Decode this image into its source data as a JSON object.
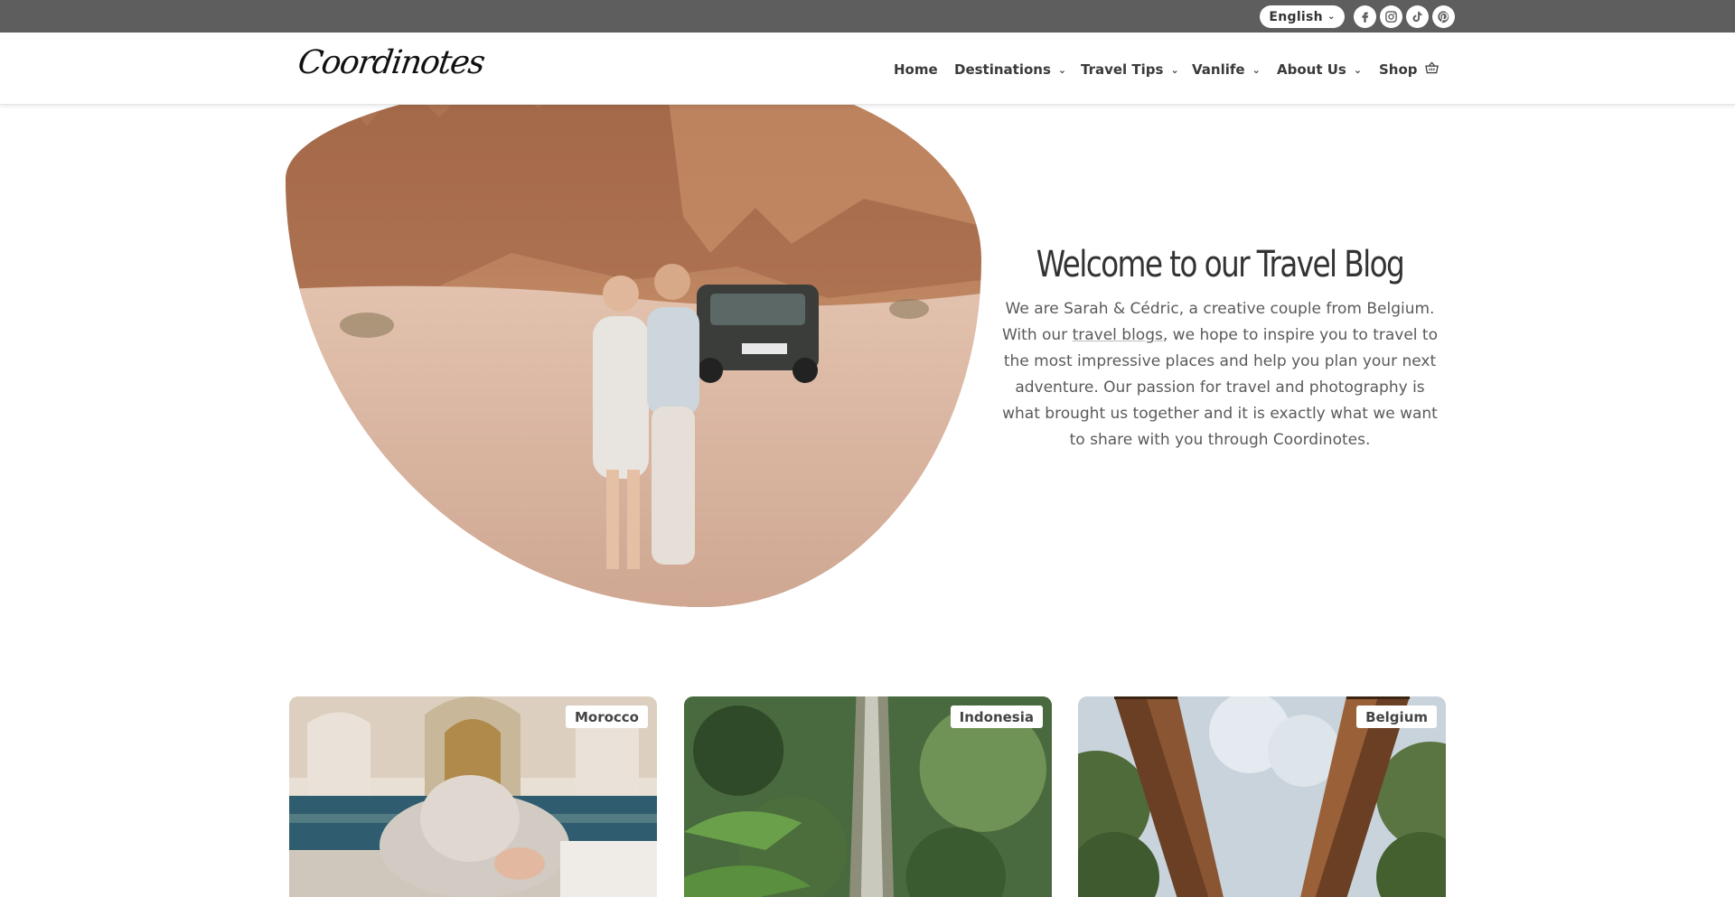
{
  "topbar": {
    "language": "English",
    "social": [
      "facebook-icon",
      "instagram-icon",
      "tiktok-icon",
      "pinterest-icon"
    ]
  },
  "header": {
    "logo": "Coordinotes",
    "nav": [
      {
        "label": "Home",
        "dropdown": false
      },
      {
        "label": "Destinations",
        "dropdown": true
      },
      {
        "label": "Travel Tips",
        "dropdown": true
      },
      {
        "label": "Vanlife",
        "dropdown": true
      },
      {
        "label": "About Us",
        "dropdown": true
      },
      {
        "label": "Shop",
        "dropdown": false,
        "icon": "basket-icon"
      }
    ]
  },
  "hero": {
    "title": "Welcome to our Travel Blog",
    "text_before": "We are Sarah & Cédric, a creative couple from Belgium. With our ",
    "link": "travel blogs",
    "text_after": ", we hope to inspire you to travel to the most impressive places and help you plan your next adventure. Our passion for travel and photography is what brought us together and it is exactly what we want to share with you through Coordinotes."
  },
  "cards": [
    {
      "tag": "Morocco"
    },
    {
      "tag": "Indonesia"
    },
    {
      "tag": "Belgium"
    }
  ]
}
